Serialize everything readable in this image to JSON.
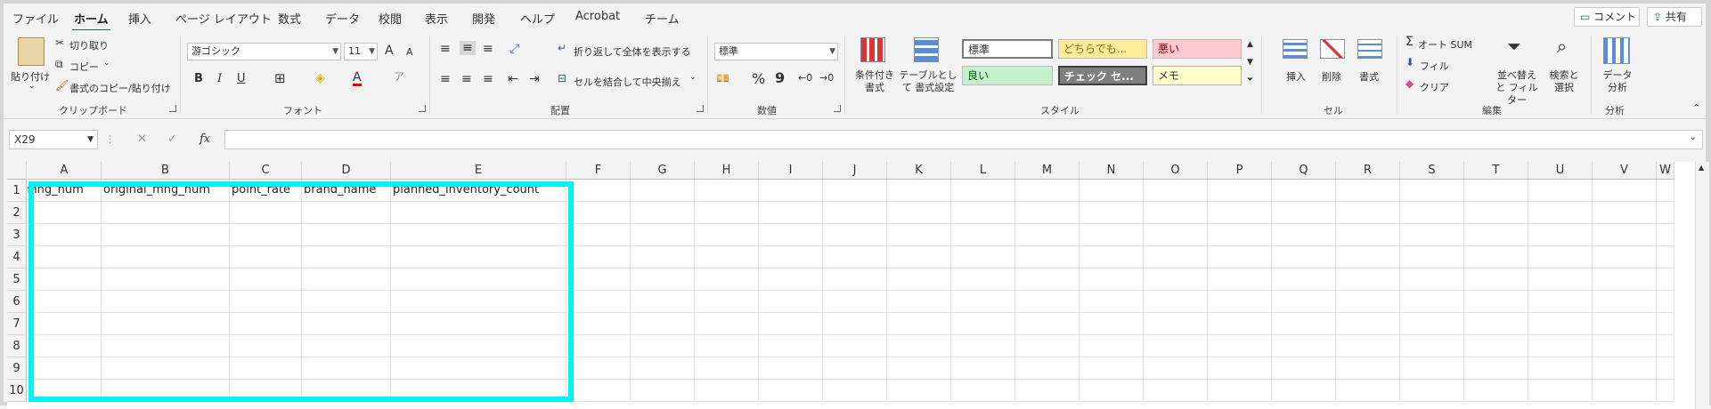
{
  "menu": {
    "tabs": [
      "ファイル",
      "ホーム",
      "挿入",
      "ページ レイアウト",
      "数式",
      "データ",
      "校閲",
      "表示",
      "開発",
      "ヘルプ",
      "Acrobat",
      "チーム"
    ],
    "comment_label": "コメント",
    "share_label": "共有"
  },
  "ribbon": {
    "clipboard": {
      "paste": "貼り付け",
      "cut": "切り取り",
      "copy": "コピー",
      "format_painter": "書式のコピー/貼り付け",
      "label": "クリップボード"
    },
    "font": {
      "name": "游ゴシック",
      "size": "11",
      "grow": "A",
      "shrink": "A",
      "bold": "B",
      "italic": "I",
      "underline": "U",
      "label": "フォント"
    },
    "alignment": {
      "wrap": "折り返して全体を表示する",
      "merge": "セルを結合して中央揃え",
      "label": "配置"
    },
    "number": {
      "format": "標準",
      "percent": "%",
      "comma": "9",
      "label": "数値"
    },
    "styles": {
      "conditional": "条件付き 書式",
      "table": "テーブルとして 書式設定",
      "cells": [
        "標準",
        "どちらでも...",
        "悪い",
        "良い",
        "チェック セ...",
        "メモ"
      ],
      "label": "スタイル"
    },
    "cells": {
      "insert": "挿入",
      "delete": "削除",
      "format": "書式",
      "label": "セル"
    },
    "editing": {
      "autosum": "オート SUM",
      "fill": "フィル",
      "clear": "クリア",
      "sort": "並べ替えと フィルター",
      "find": "検索と 選択",
      "label": "編集"
    },
    "analysis": {
      "analyze": "データ 分析",
      "label": "分析"
    }
  },
  "formula_bar": {
    "name_box": "X29",
    "fx": "fx",
    "cancel": "✕",
    "enter": "✓",
    "formula": ""
  },
  "sheet": {
    "columns": [
      "A",
      "B",
      "C",
      "D",
      "E",
      "F",
      "G",
      "H",
      "I",
      "J",
      "K",
      "L",
      "M",
      "N",
      "O",
      "P",
      "Q",
      "R",
      "S",
      "T",
      "U",
      "V",
      "W"
    ],
    "rows": [
      "1",
      "2",
      "3",
      "4",
      "5",
      "6",
      "7",
      "8",
      "9",
      "10"
    ],
    "row1": [
      "mng_num",
      "original_mng_num",
      "point_rate",
      "brand_name",
      "planned_inventory_count"
    ]
  },
  "colors": {
    "highlight": "#00f4f4",
    "accent": "#217346"
  }
}
